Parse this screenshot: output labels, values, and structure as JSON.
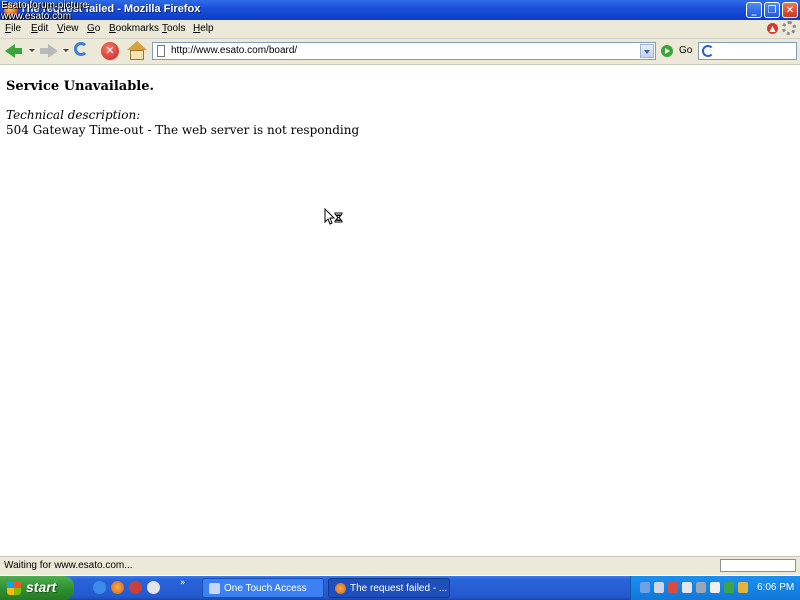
{
  "watermark": {
    "line1": "Esato forum picture",
    "line2": "www.esato.com"
  },
  "window": {
    "title": "The request failed - Mozilla Firefox"
  },
  "menu": {
    "items": [
      "File",
      "Edit",
      "View",
      "Go",
      "Bookmarks",
      "Tools",
      "Help"
    ]
  },
  "toolbar": {
    "url": "http://www.esato.com/board/",
    "go_label": "Go"
  },
  "content": {
    "heading": "Service Unavailable.",
    "tech_label": "Technical description:",
    "tech_desc": "504 Gateway Time-out - The web server is not responding"
  },
  "status": {
    "text": "Waiting for www.esato.com..."
  },
  "taskbar": {
    "start_label": "start",
    "tasks": [
      {
        "label": "One Touch Access"
      },
      {
        "label": "The request failed - ..."
      }
    ],
    "clock": "6:06 PM"
  },
  "icons": {
    "back": "back-arrow-icon",
    "forward": "forward-arrow-icon",
    "reload": "reload-icon",
    "stop": "stop-icon",
    "home": "home-icon",
    "go": "go-icon",
    "search": "google-search-icon",
    "cursor": "busy-cursor-icon"
  },
  "colors": {
    "titlebar": "#0a3cc9",
    "chrome": "#ece9d8",
    "taskbar": "#245ad0",
    "start": "#2f8e2f"
  }
}
